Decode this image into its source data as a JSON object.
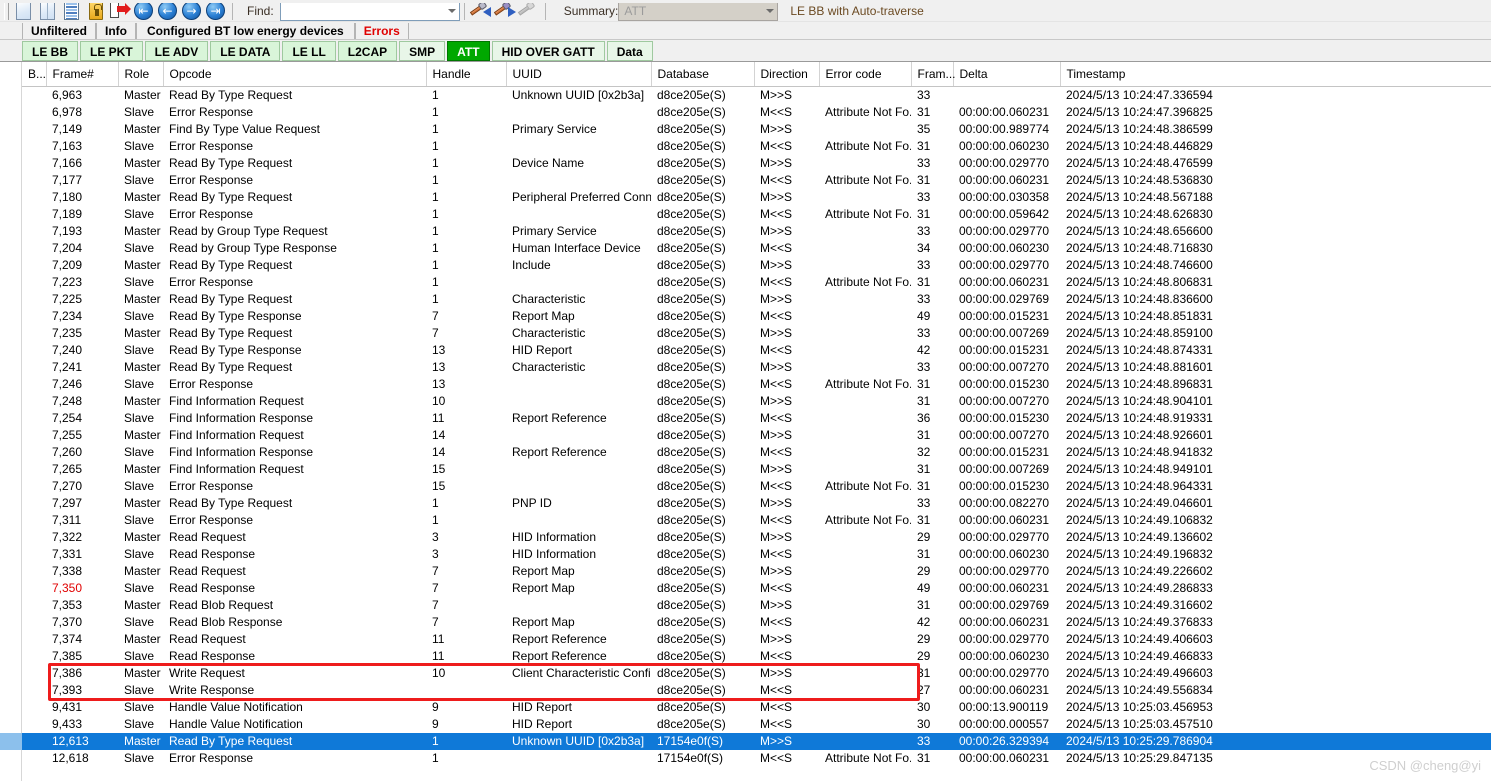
{
  "toolbar": {
    "icons": [
      {
        "name": "new-window-icon",
        "kind": "page"
      },
      {
        "name": "split-view-icon",
        "kind": "page-split"
      },
      {
        "name": "list-view-icon",
        "kind": "lines"
      },
      {
        "name": "lock-icon",
        "kind": "lock"
      },
      {
        "name": "export-icon",
        "kind": "export"
      },
      {
        "name": "go-first-icon",
        "kind": "circle",
        "glyph": "⇤"
      },
      {
        "name": "go-previous-icon",
        "kind": "circle",
        "glyph": "←"
      },
      {
        "name": "go-next-icon",
        "kind": "circle",
        "glyph": "→"
      },
      {
        "name": "go-last-icon",
        "kind": "circle",
        "glyph": "⇥"
      }
    ],
    "find_label": "Find:",
    "find_value": "",
    "find_placeholder": "",
    "find_prev_icon": "find-previous-icon",
    "find_next_icon": "find-next-icon",
    "find_disabled_icon": "find-tool-disabled-icon",
    "summary_label": "Summary:",
    "summary_value": "ATT",
    "summary_note": "LE BB with Auto-traverse"
  },
  "view_tabs": [
    {
      "label": "Unfiltered",
      "state": "normal"
    },
    {
      "label": "Info",
      "state": "normal"
    },
    {
      "label": "Configured BT low energy devices",
      "state": "normal"
    },
    {
      "label": "Errors",
      "state": "error"
    }
  ],
  "layer_tabs": [
    {
      "label": "LE BB",
      "active": false
    },
    {
      "label": "LE PKT",
      "active": false
    },
    {
      "label": "LE ADV",
      "active": false
    },
    {
      "label": "LE DATA",
      "active": false
    },
    {
      "label": "LE LL",
      "active": false
    },
    {
      "label": "L2CAP",
      "active": false
    },
    {
      "label": "SMP",
      "active": false
    },
    {
      "label": "ATT",
      "active": true
    },
    {
      "label": "HID OVER GATT",
      "active": false
    },
    {
      "label": "Data",
      "active": false
    }
  ],
  "grid": {
    "columns": [
      "B...",
      "Frame#",
      "Role",
      "Opcode",
      "Handle",
      "UUID",
      "Database",
      "Direction",
      "Error code",
      "Fram...",
      "Delta",
      "Timestamp"
    ],
    "rows": [
      {
        "frame": "6,963",
        "role": "Master",
        "opcode": "Read By Type Request",
        "handle": "1",
        "uuid": "Unknown UUID [0x2b3a]",
        "db": "d8ce205e(S)",
        "dir": "M>>S",
        "err": "",
        "fram": "33",
        "delta": "",
        "ts": "2024/5/13 10:24:47.336594",
        "selected": false,
        "frame_red": false
      },
      {
        "frame": "6,978",
        "role": "Slave",
        "opcode": "Error Response",
        "handle": "1",
        "uuid": "",
        "db": "d8ce205e(S)",
        "dir": "M<<S",
        "err": "Attribute Not Fo...",
        "fram": "31",
        "delta": "00:00:00.060231",
        "ts": "2024/5/13 10:24:47.396825",
        "selected": false,
        "frame_red": false
      },
      {
        "frame": "7,149",
        "role": "Master",
        "opcode": "Find By Type Value Request",
        "handle": "1",
        "uuid": "Primary Service",
        "db": "d8ce205e(S)",
        "dir": "M>>S",
        "err": "",
        "fram": "35",
        "delta": "00:00:00.989774",
        "ts": "2024/5/13 10:24:48.386599",
        "selected": false,
        "frame_red": false
      },
      {
        "frame": "7,163",
        "role": "Slave",
        "opcode": "Error Response",
        "handle": "1",
        "uuid": "",
        "db": "d8ce205e(S)",
        "dir": "M<<S",
        "err": "Attribute Not Fo...",
        "fram": "31",
        "delta": "00:00:00.060230",
        "ts": "2024/5/13 10:24:48.446829",
        "selected": false,
        "frame_red": false
      },
      {
        "frame": "7,166",
        "role": "Master",
        "opcode": "Read By Type Request",
        "handle": "1",
        "uuid": "Device Name",
        "db": "d8ce205e(S)",
        "dir": "M>>S",
        "err": "",
        "fram": "33",
        "delta": "00:00:00.029770",
        "ts": "2024/5/13 10:24:48.476599",
        "selected": false,
        "frame_red": false
      },
      {
        "frame": "7,177",
        "role": "Slave",
        "opcode": "Error Response",
        "handle": "1",
        "uuid": "",
        "db": "d8ce205e(S)",
        "dir": "M<<S",
        "err": "Attribute Not Fo...",
        "fram": "31",
        "delta": "00:00:00.060231",
        "ts": "2024/5/13 10:24:48.536830",
        "selected": false,
        "frame_red": false
      },
      {
        "frame": "7,180",
        "role": "Master",
        "opcode": "Read By Type Request",
        "handle": "1",
        "uuid": "Peripheral Preferred Conne...",
        "db": "d8ce205e(S)",
        "dir": "M>>S",
        "err": "",
        "fram": "33",
        "delta": "00:00:00.030358",
        "ts": "2024/5/13 10:24:48.567188",
        "selected": false,
        "frame_red": false
      },
      {
        "frame": "7,189",
        "role": "Slave",
        "opcode": "Error Response",
        "handle": "1",
        "uuid": "",
        "db": "d8ce205e(S)",
        "dir": "M<<S",
        "err": "Attribute Not Fo...",
        "fram": "31",
        "delta": "00:00:00.059642",
        "ts": "2024/5/13 10:24:48.626830",
        "selected": false,
        "frame_red": false
      },
      {
        "frame": "7,193",
        "role": "Master",
        "opcode": "Read by Group Type Request",
        "handle": "1",
        "uuid": "Primary Service",
        "db": "d8ce205e(S)",
        "dir": "M>>S",
        "err": "",
        "fram": "33",
        "delta": "00:00:00.029770",
        "ts": "2024/5/13 10:24:48.656600",
        "selected": false,
        "frame_red": false
      },
      {
        "frame": "7,204",
        "role": "Slave",
        "opcode": "Read by Group Type Response",
        "handle": "1",
        "uuid": "Human Interface Device",
        "db": "d8ce205e(S)",
        "dir": "M<<S",
        "err": "",
        "fram": "34",
        "delta": "00:00:00.060230",
        "ts": "2024/5/13 10:24:48.716830",
        "selected": false,
        "frame_red": false
      },
      {
        "frame": "7,209",
        "role": "Master",
        "opcode": "Read By Type Request",
        "handle": "1",
        "uuid": "Include",
        "db": "d8ce205e(S)",
        "dir": "M>>S",
        "err": "",
        "fram": "33",
        "delta": "00:00:00.029770",
        "ts": "2024/5/13 10:24:48.746600",
        "selected": false,
        "frame_red": false
      },
      {
        "frame": "7,223",
        "role": "Slave",
        "opcode": "Error Response",
        "handle": "1",
        "uuid": "",
        "db": "d8ce205e(S)",
        "dir": "M<<S",
        "err": "Attribute Not Fo...",
        "fram": "31",
        "delta": "00:00:00.060231",
        "ts": "2024/5/13 10:24:48.806831",
        "selected": false,
        "frame_red": false
      },
      {
        "frame": "7,225",
        "role": "Master",
        "opcode": "Read By Type Request",
        "handle": "1",
        "uuid": "Characteristic",
        "db": "d8ce205e(S)",
        "dir": "M>>S",
        "err": "",
        "fram": "33",
        "delta": "00:00:00.029769",
        "ts": "2024/5/13 10:24:48.836600",
        "selected": false,
        "frame_red": false
      },
      {
        "frame": "7,234",
        "role": "Slave",
        "opcode": "Read By Type Response",
        "handle": "7",
        "uuid": "Report Map",
        "db": "d8ce205e(S)",
        "dir": "M<<S",
        "err": "",
        "fram": "49",
        "delta": "00:00:00.015231",
        "ts": "2024/5/13 10:24:48.851831",
        "selected": false,
        "frame_red": false
      },
      {
        "frame": "7,235",
        "role": "Master",
        "opcode": "Read By Type Request",
        "handle": "7",
        "uuid": "Characteristic",
        "db": "d8ce205e(S)",
        "dir": "M>>S",
        "err": "",
        "fram": "33",
        "delta": "00:00:00.007269",
        "ts": "2024/5/13 10:24:48.859100",
        "selected": false,
        "frame_red": false
      },
      {
        "frame": "7,240",
        "role": "Slave",
        "opcode": "Read By Type Response",
        "handle": "13",
        "uuid": "HID Report",
        "db": "d8ce205e(S)",
        "dir": "M<<S",
        "err": "",
        "fram": "42",
        "delta": "00:00:00.015231",
        "ts": "2024/5/13 10:24:48.874331",
        "selected": false,
        "frame_red": false
      },
      {
        "frame": "7,241",
        "role": "Master",
        "opcode": "Read By Type Request",
        "handle": "13",
        "uuid": "Characteristic",
        "db": "d8ce205e(S)",
        "dir": "M>>S",
        "err": "",
        "fram": "33",
        "delta": "00:00:00.007270",
        "ts": "2024/5/13 10:24:48.881601",
        "selected": false,
        "frame_red": false
      },
      {
        "frame": "7,246",
        "role": "Slave",
        "opcode": "Error Response",
        "handle": "13",
        "uuid": "",
        "db": "d8ce205e(S)",
        "dir": "M<<S",
        "err": "Attribute Not Fo...",
        "fram": "31",
        "delta": "00:00:00.015230",
        "ts": "2024/5/13 10:24:48.896831",
        "selected": false,
        "frame_red": false
      },
      {
        "frame": "7,248",
        "role": "Master",
        "opcode": "Find Information Request",
        "handle": "10",
        "uuid": "",
        "db": "d8ce205e(S)",
        "dir": "M>>S",
        "err": "",
        "fram": "31",
        "delta": "00:00:00.007270",
        "ts": "2024/5/13 10:24:48.904101",
        "selected": false,
        "frame_red": false
      },
      {
        "frame": "7,254",
        "role": "Slave",
        "opcode": "Find Information Response",
        "handle": "11",
        "uuid": "Report Reference",
        "db": "d8ce205e(S)",
        "dir": "M<<S",
        "err": "",
        "fram": "36",
        "delta": "00:00:00.015230",
        "ts": "2024/5/13 10:24:48.919331",
        "selected": false,
        "frame_red": false
      },
      {
        "frame": "7,255",
        "role": "Master",
        "opcode": "Find Information Request",
        "handle": "14",
        "uuid": "",
        "db": "d8ce205e(S)",
        "dir": "M>>S",
        "err": "",
        "fram": "31",
        "delta": "00:00:00.007270",
        "ts": "2024/5/13 10:24:48.926601",
        "selected": false,
        "frame_red": false
      },
      {
        "frame": "7,260",
        "role": "Slave",
        "opcode": "Find Information Response",
        "handle": "14",
        "uuid": "Report Reference",
        "db": "d8ce205e(S)",
        "dir": "M<<S",
        "err": "",
        "fram": "32",
        "delta": "00:00:00.015231",
        "ts": "2024/5/13 10:24:48.941832",
        "selected": false,
        "frame_red": false
      },
      {
        "frame": "7,265",
        "role": "Master",
        "opcode": "Find Information Request",
        "handle": "15",
        "uuid": "",
        "db": "d8ce205e(S)",
        "dir": "M>>S",
        "err": "",
        "fram": "31",
        "delta": "00:00:00.007269",
        "ts": "2024/5/13 10:24:48.949101",
        "selected": false,
        "frame_red": false
      },
      {
        "frame": "7,270",
        "role": "Slave",
        "opcode": "Error Response",
        "handle": "15",
        "uuid": "",
        "db": "d8ce205e(S)",
        "dir": "M<<S",
        "err": "Attribute Not Fo...",
        "fram": "31",
        "delta": "00:00:00.015230",
        "ts": "2024/5/13 10:24:48.964331",
        "selected": false,
        "frame_red": false
      },
      {
        "frame": "7,297",
        "role": "Master",
        "opcode": "Read By Type Request",
        "handle": "1",
        "uuid": "PNP ID",
        "db": "d8ce205e(S)",
        "dir": "M>>S",
        "err": "",
        "fram": "33",
        "delta": "00:00:00.082270",
        "ts": "2024/5/13 10:24:49.046601",
        "selected": false,
        "frame_red": false
      },
      {
        "frame": "7,311",
        "role": "Slave",
        "opcode": "Error Response",
        "handle": "1",
        "uuid": "",
        "db": "d8ce205e(S)",
        "dir": "M<<S",
        "err": "Attribute Not Fo...",
        "fram": "31",
        "delta": "00:00:00.060231",
        "ts": "2024/5/13 10:24:49.106832",
        "selected": false,
        "frame_red": false
      },
      {
        "frame": "7,322",
        "role": "Master",
        "opcode": "Read Request",
        "handle": "3",
        "uuid": "HID Information",
        "db": "d8ce205e(S)",
        "dir": "M>>S",
        "err": "",
        "fram": "29",
        "delta": "00:00:00.029770",
        "ts": "2024/5/13 10:24:49.136602",
        "selected": false,
        "frame_red": false
      },
      {
        "frame": "7,331",
        "role": "Slave",
        "opcode": "Read Response",
        "handle": "3",
        "uuid": "HID Information",
        "db": "d8ce205e(S)",
        "dir": "M<<S",
        "err": "",
        "fram": "31",
        "delta": "00:00:00.060230",
        "ts": "2024/5/13 10:24:49.196832",
        "selected": false,
        "frame_red": false
      },
      {
        "frame": "7,338",
        "role": "Master",
        "opcode": "Read Request",
        "handle": "7",
        "uuid": "Report Map",
        "db": "d8ce205e(S)",
        "dir": "M>>S",
        "err": "",
        "fram": "29",
        "delta": "00:00:00.029770",
        "ts": "2024/5/13 10:24:49.226602",
        "selected": false,
        "frame_red": false
      },
      {
        "frame": "7,350",
        "role": "Slave",
        "opcode": "Read Response",
        "handle": "7",
        "uuid": "Report Map",
        "db": "d8ce205e(S)",
        "dir": "M<<S",
        "err": "",
        "fram": "49",
        "delta": "00:00:00.060231",
        "ts": "2024/5/13 10:24:49.286833",
        "selected": false,
        "frame_red": true
      },
      {
        "frame": "7,353",
        "role": "Master",
        "opcode": "Read Blob Request",
        "handle": "7",
        "uuid": "",
        "db": "d8ce205e(S)",
        "dir": "M>>S",
        "err": "",
        "fram": "31",
        "delta": "00:00:00.029769",
        "ts": "2024/5/13 10:24:49.316602",
        "selected": false,
        "frame_red": false
      },
      {
        "frame": "7,370",
        "role": "Slave",
        "opcode": "Read Blob Response",
        "handle": "7",
        "uuid": "Report Map",
        "db": "d8ce205e(S)",
        "dir": "M<<S",
        "err": "",
        "fram": "42",
        "delta": "00:00:00.060231",
        "ts": "2024/5/13 10:24:49.376833",
        "selected": false,
        "frame_red": false
      },
      {
        "frame": "7,374",
        "role": "Master",
        "opcode": "Read Request",
        "handle": "11",
        "uuid": "Report Reference",
        "db": "d8ce205e(S)",
        "dir": "M>>S",
        "err": "",
        "fram": "29",
        "delta": "00:00:00.029770",
        "ts": "2024/5/13 10:24:49.406603",
        "selected": false,
        "frame_red": false
      },
      {
        "frame": "7,385",
        "role": "Slave",
        "opcode": "Read Response",
        "handle": "11",
        "uuid": "Report Reference",
        "db": "d8ce205e(S)",
        "dir": "M<<S",
        "err": "",
        "fram": "29",
        "delta": "00:00:00.060230",
        "ts": "2024/5/13 10:24:49.466833",
        "selected": false,
        "frame_red": false
      },
      {
        "frame": "7,386",
        "role": "Master",
        "opcode": "Write Request",
        "handle": "10",
        "uuid": "Client Characteristic Config...",
        "db": "d8ce205e(S)",
        "dir": "M>>S",
        "err": "",
        "fram": "31",
        "delta": "00:00:00.029770",
        "ts": "2024/5/13 10:24:49.496603",
        "selected": false,
        "frame_red": false
      },
      {
        "frame": "7,393",
        "role": "Slave",
        "opcode": "Write Response",
        "handle": "",
        "uuid": "",
        "db": "d8ce205e(S)",
        "dir": "M<<S",
        "err": "",
        "fram": "27",
        "delta": "00:00:00.060231",
        "ts": "2024/5/13 10:24:49.556834",
        "selected": false,
        "frame_red": false
      },
      {
        "frame": "9,431",
        "role": "Slave",
        "opcode": "Handle Value Notification",
        "handle": "9",
        "uuid": "HID Report",
        "db": "d8ce205e(S)",
        "dir": "M<<S",
        "err": "",
        "fram": "30",
        "delta": "00:00:13.900119",
        "ts": "2024/5/13 10:25:03.456953",
        "selected": false,
        "frame_red": false
      },
      {
        "frame": "9,433",
        "role": "Slave",
        "opcode": "Handle Value Notification",
        "handle": "9",
        "uuid": "HID Report",
        "db": "d8ce205e(S)",
        "dir": "M<<S",
        "err": "",
        "fram": "30",
        "delta": "00:00:00.000557",
        "ts": "2024/5/13 10:25:03.457510",
        "selected": false,
        "frame_red": false
      },
      {
        "frame": "12,613",
        "role": "Master",
        "opcode": "Read By Type Request",
        "handle": "1",
        "uuid": "Unknown UUID [0x2b3a]",
        "db": "17154e0f(S)",
        "dir": "M>>S",
        "err": "",
        "fram": "33",
        "delta": "00:00:26.329394",
        "ts": "2024/5/13 10:25:29.786904",
        "selected": true,
        "frame_red": false
      },
      {
        "frame": "12,618",
        "role": "Slave",
        "opcode": "Error Response",
        "handle": "1",
        "uuid": "",
        "db": "17154e0f(S)",
        "dir": "M<<S",
        "err": "Attribute Not Fo...",
        "fram": "31",
        "delta": "00:00:00.060231",
        "ts": "2024/5/13 10:25:29.847135",
        "selected": false,
        "frame_red": false
      }
    ],
    "highlight_boxes": [
      {
        "label": "write-request-response-highlight",
        "rows": [
          34,
          35
        ]
      }
    ]
  },
  "watermark": "CSDN @cheng@yi"
}
